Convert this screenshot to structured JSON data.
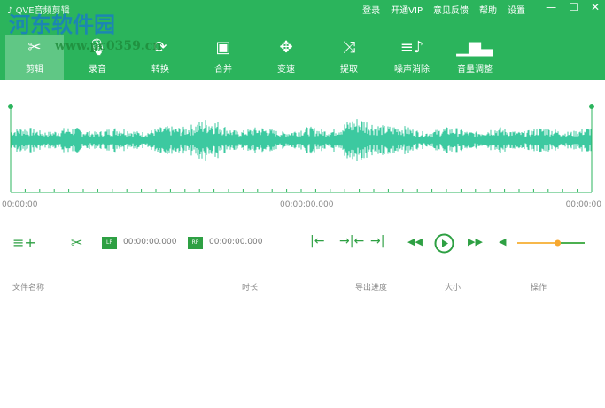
{
  "title": "QVE音频剪辑",
  "menu": [
    "登录",
    "开通VIP",
    "意见反馈",
    "帮助",
    "设置"
  ],
  "window_controls": [
    "—",
    "☐",
    "✕"
  ],
  "tools": [
    {
      "label": "剪辑",
      "icon": "scissors-icon"
    },
    {
      "label": "录音",
      "icon": "mic-icon"
    },
    {
      "label": "转换",
      "icon": "convert-icon"
    },
    {
      "label": "合并",
      "icon": "merge-icon"
    },
    {
      "label": "变速",
      "icon": "speed-icon"
    },
    {
      "label": "提取",
      "icon": "shuffle-icon"
    },
    {
      "label": "噪声消除",
      "icon": "noise-icon"
    },
    {
      "label": "音量调整",
      "icon": "volume-bars-icon"
    }
  ],
  "watermark": {
    "text": "河东软件园",
    "url": "www.pc0359.cn"
  },
  "timeline": {
    "start": "00:00:00",
    "mid": "00:00:00.000",
    "end": "00:00:00"
  },
  "controls": {
    "left_point_label": "LP",
    "left_time": "00:00:00.000",
    "right_point_label": "RP",
    "right_time": "00:00:00.000",
    "volume": 0.6
  },
  "table_headers": [
    "文件名称",
    "时长",
    "导出进度",
    "大小",
    "操作"
  ],
  "colors": {
    "brand": "#2bb45c",
    "wave": "#3cc9a0",
    "slider": "#f7b84b"
  }
}
